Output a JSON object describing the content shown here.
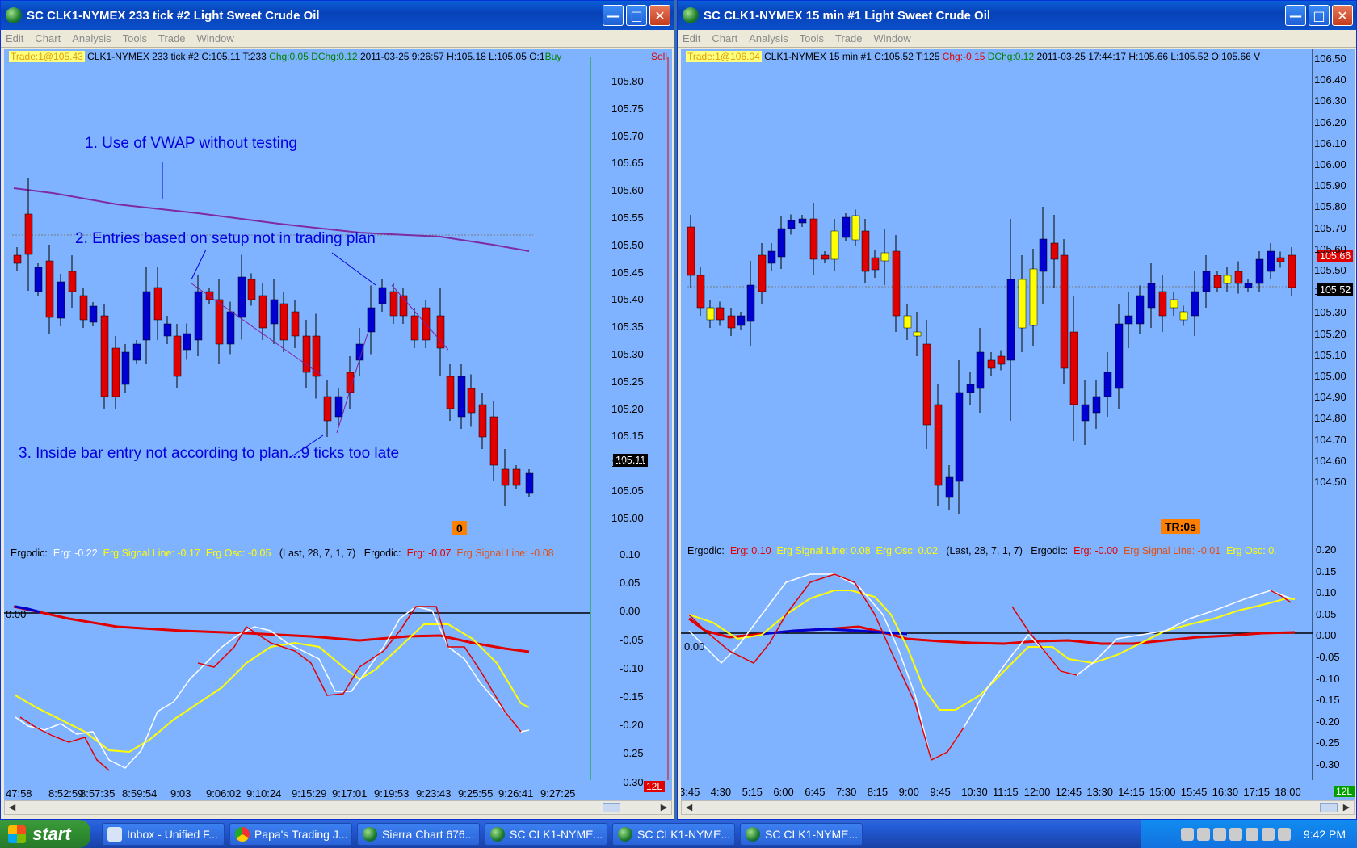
{
  "left": {
    "title": "SC CLK1-NYMEX  233 tick  #2  Light Sweet Crude Oil",
    "menu": [
      "Edit",
      "Chart",
      "Analysis",
      "Tools",
      "Trade",
      "Window"
    ],
    "info": {
      "trade": "Trade:1@105.43",
      "symbol": "CLK1-NYMEX  233 tick  #2 C:105.11 T:233",
      "chg": "Chg:0.05",
      "dchg": "DChg:0.12",
      "rest": "2011-03-25  9:26:57 H:105.18 L:105.05 O:1",
      "buy": "Buy",
      "sell": "Sell"
    },
    "annotations": {
      "a1": "1. Use of VWAP without testing",
      "a2": "2.  Entries based on setup not in trading plan",
      "a3": "3.  Inside bar entry not according to plan...9 ticks too late"
    },
    "badge": "0",
    "current_price": "105.11",
    "price_ticks": [
      "105.80",
      "105.75",
      "105.70",
      "105.65",
      "105.60",
      "105.55",
      "105.50",
      "105.45",
      "105.40",
      "105.35",
      "105.30",
      "105.25",
      "105.20",
      "105.15",
      "105.10",
      "105.05",
      "105.00"
    ],
    "erg_ticks": [
      "0.10",
      "0.05",
      "0.00",
      "-0.05",
      "-0.10",
      "-0.15",
      "-0.20",
      "-0.25",
      "-0.30"
    ],
    "erg_legend": {
      "label": "Ergodic:",
      "erg": "Erg: -0.22",
      "sig": "Erg Signal Line: -0.17",
      "osc": "Erg Osc: -0.05",
      "params": "(Last, 28, 7, 1, 7)",
      "label2": "Ergodic:",
      "erg2": "Erg: -0.07",
      "sig2": "Erg Signal Line: -0.08"
    },
    "zero_label": "0.00",
    "time_ticks": [
      "47:58",
      "8:52:59",
      "8:57:35",
      "8:59:54",
      "9:03",
      "9:06:02",
      "9:10:24",
      "9:15:29",
      "9:17:01",
      "9:19:53",
      "9:23:43",
      "9:25:55",
      "9:26:41",
      "9:27:25"
    ],
    "corner": "12L"
  },
  "right": {
    "title": "SC CLK1-NYMEX  15 min   #1  Light Sweet Crude Oil",
    "menu": [
      "Edit",
      "Chart",
      "Analysis",
      "Tools",
      "Trade",
      "Window"
    ],
    "info": {
      "trade": "Trade:1@106.04",
      "symbol": "CLK1-NYMEX  15 min   #1 C:105.52 T:125",
      "chg": "Chg:-0.15",
      "dchg": "DChg:0.12",
      "rest": "2011-03-25 17:44:17 H:105.66 L:105.52 O:105.66 V"
    },
    "badge": "TR:0s",
    "price_high_box": "105.66",
    "price_close_box": "105.52",
    "price_ticks": [
      "106.50",
      "106.40",
      "106.30",
      "106.20",
      "106.10",
      "106.00",
      "105.90",
      "105.80",
      "105.70",
      "105.60",
      "105.50",
      "105.40",
      "105.30",
      "105.20",
      "105.10",
      "105.00",
      "104.90",
      "104.80",
      "104.70",
      "104.60",
      "104.50"
    ],
    "erg_ticks": [
      "0.20",
      "0.15",
      "0.10",
      "0.05",
      "0.00",
      "-0.05",
      "-0.10",
      "-0.15",
      "-0.20",
      "-0.25",
      "-0.30"
    ],
    "erg_legend": {
      "label": "Ergodic:",
      "erg": "Erg: 0.10",
      "sig": "Erg Signal Line: 0.08",
      "osc": "Erg Osc: 0.02",
      "params": "(Last, 28, 7, 1, 7)",
      "label2": "Ergodic:",
      "erg2": "Erg: -0.00",
      "sig2": "Erg Signal Line: -0.01",
      "osc2": "Erg Osc: 0."
    },
    "zero_label": "0.00",
    "time_ticks": [
      "3:45",
      "4:30",
      "5:15",
      "6:00",
      "6:45",
      "7:30",
      "8:15",
      "9:00",
      "9:45",
      "10:30",
      "11:15",
      "12:00",
      "12:45",
      "13:30",
      "14:15",
      "15:00",
      "15:45",
      "16:30",
      "17:15",
      "18:00"
    ],
    "corner": "12L"
  },
  "taskbar": {
    "start": "start",
    "tasks": [
      "Inbox - Unified F...",
      "Papa's Trading J...",
      "Sierra Chart 676...",
      "SC CLK1-NYME...",
      "SC CLK1-NYME...",
      "SC CLK1-NYME..."
    ],
    "clock": "9:42 PM"
  }
}
